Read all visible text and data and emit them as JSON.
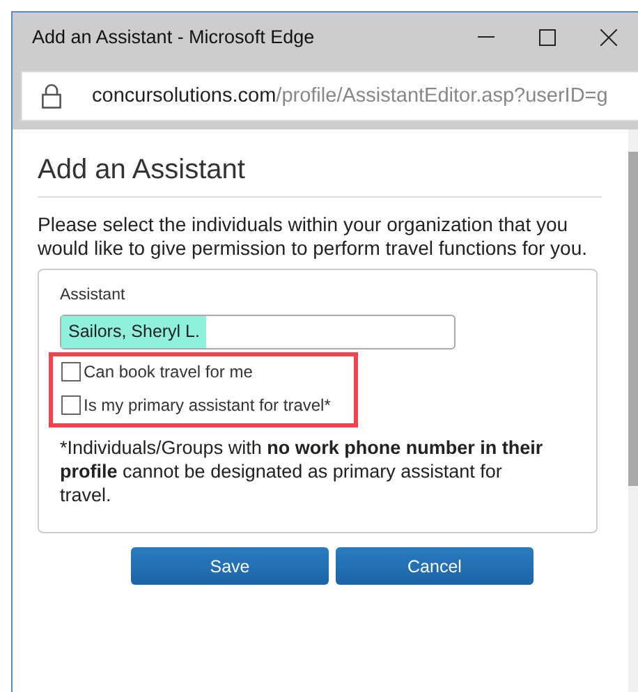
{
  "window": {
    "title": "Add an Assistant - Microsoft Edge"
  },
  "address_bar": {
    "domain": "concursolutions.com",
    "path": "/profile/AssistantEditor.asp?userID=g"
  },
  "heading": "Add an Assistant",
  "intro": "Please select the individuals within your organization that you would like to give permission to perform travel functions for you.",
  "assistant": {
    "label": "Assistant",
    "value": "Sailors, Sheryl L.",
    "highlighted": true
  },
  "options_framed": true,
  "options": [
    {
      "label": "Can book travel for me",
      "checked": false
    },
    {
      "label": "Is my primary assistant for travel*",
      "checked": false
    }
  ],
  "footnote": "*Individuals/Groups with **no work phone number in their profile** cannot be designated as primary assistant for travel.",
  "buttons": [
    "Save",
    "Cancel"
  ]
}
